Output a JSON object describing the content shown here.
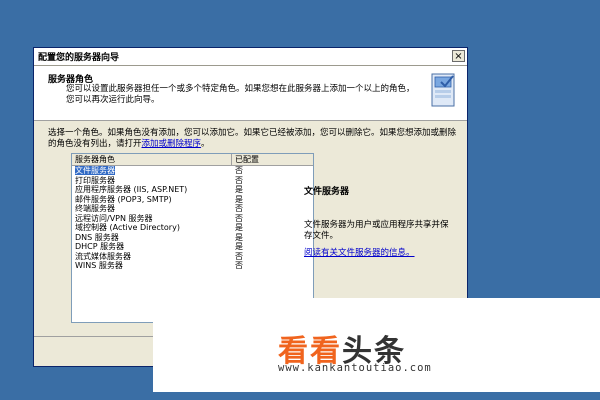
{
  "window": {
    "title": "配置您的服务器向导",
    "close_glyph": "×"
  },
  "header": {
    "title": "服务器角色",
    "description": "您可以设置此服务器担任一个或多个特定角色。如果您想在此服务器上添加一个以上的角色，您可以再次运行此向导。",
    "icon": "server-wizard-icon"
  },
  "intro": {
    "text": "选择一个角色。如果角色没有添加，您可以添加它。如果它已经被添加，您可以删除它。如果您想添加或删除的角色没有列出，请打开",
    "link": "添加或删除程序",
    "tail": "。"
  },
  "role_list": {
    "columns": [
      "服务器角色",
      "已配置"
    ],
    "rows": [
      {
        "role": "文件服务器",
        "configured": "否",
        "selected": true
      },
      {
        "role": "打印服务器",
        "configured": "否"
      },
      {
        "role": "应用程序服务器 (IIS, ASP.NET)",
        "configured": "是"
      },
      {
        "role": "邮件服务器 (POP3, SMTP)",
        "configured": "是"
      },
      {
        "role": "终端服务器",
        "configured": "否"
      },
      {
        "role": "远程访问/VPN 服务器",
        "configured": "否"
      },
      {
        "role": "域控制器 (Active Directory)",
        "configured": "是"
      },
      {
        "role": "DNS 服务器",
        "configured": "是"
      },
      {
        "role": "DHCP 服务器",
        "configured": "是"
      },
      {
        "role": "流式媒体服务器",
        "configured": "否"
      },
      {
        "role": "WINS 服务器",
        "configured": "否"
      }
    ]
  },
  "detail": {
    "title": "文件服务器",
    "description": "文件服务器为用户或应用程序共享并保存文件。",
    "link": "阅读有关文件服务器的信息。"
  },
  "watermark": {
    "part1": "看看",
    "part2": "头条",
    "url": "www.kankantoutiao.com",
    "colors": {
      "accent": "#f0641e",
      "dark": "#333333"
    }
  }
}
